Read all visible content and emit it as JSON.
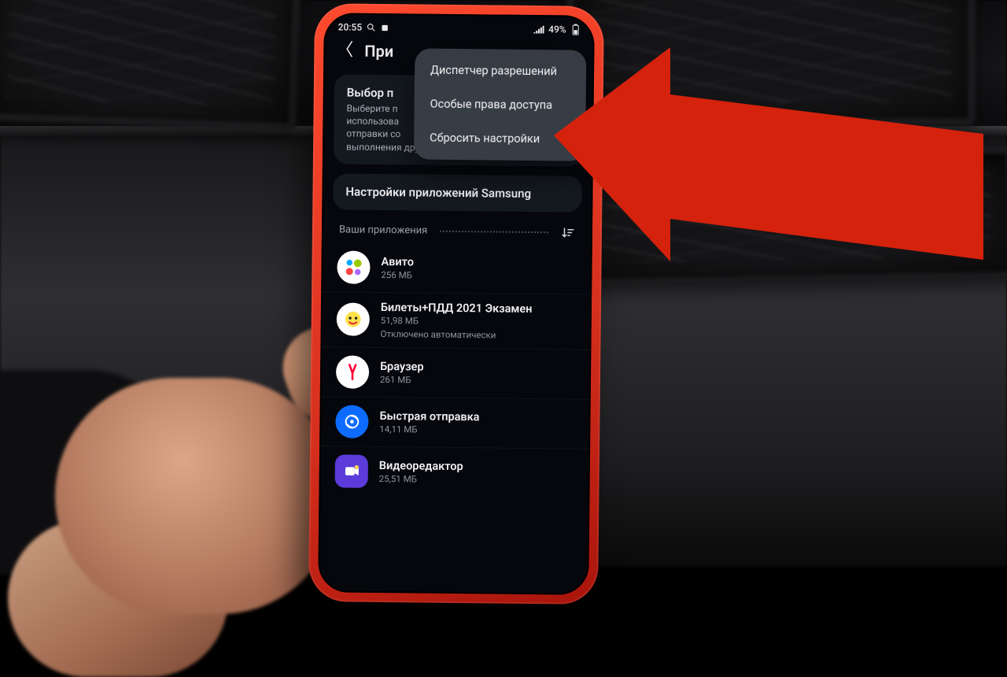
{
  "statusbar": {
    "time": "20:55",
    "battery": "49%"
  },
  "header": {
    "title": "При"
  },
  "choose": {
    "title": "Выбор п",
    "body_l1": "Выберите п",
    "body_l2": "использова",
    "body_l3": "отправки со",
    "body_l4": "выполнения других действии."
  },
  "samsung_row": "Настройки приложений Samsung",
  "section_label": "Ваши приложения",
  "menu": {
    "item1": "Диспетчер разрешений",
    "item2": "Особые права доступа",
    "item3": "Сбросить настройки"
  },
  "apps": [
    {
      "name": "Авито",
      "size": "256 МБ",
      "status": ""
    },
    {
      "name": "Билеты+ПДД 2021 Экзамен",
      "size": "51,98 МБ",
      "status": "Отключено автоматически"
    },
    {
      "name": "Браузер",
      "size": "261 МБ",
      "status": ""
    },
    {
      "name": "Быстрая отправка",
      "size": "14,11 МБ",
      "status": ""
    },
    {
      "name": "Видеоредактор",
      "size": "25,51 МБ",
      "status": ""
    }
  ]
}
